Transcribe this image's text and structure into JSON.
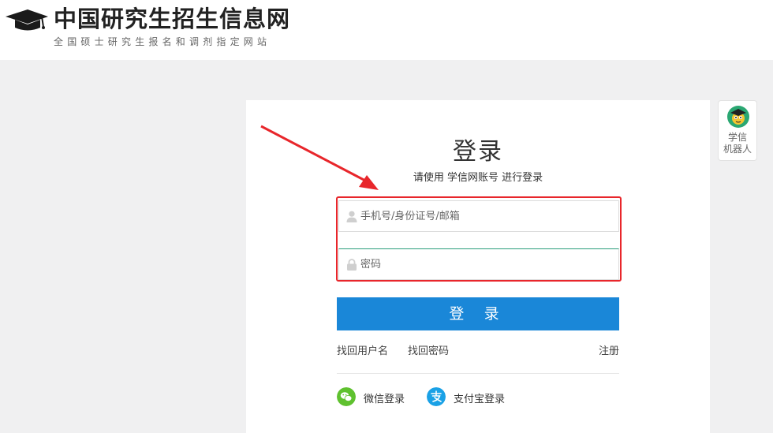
{
  "header": {
    "title": "中国研究生招生信息网",
    "subtitle": "全国硕士研究生报名和调剂指定网站"
  },
  "login": {
    "title": "登录",
    "subtitle": "请使用 学信网账号 进行登录",
    "username": {
      "placeholder": "手机号/身份证号/邮箱",
      "value": "",
      "icon": "user-icon"
    },
    "password": {
      "placeholder": "密码",
      "value": "",
      "icon": "lock-icon"
    },
    "submit_label": "登 录",
    "links": {
      "find_username": "找回用户名",
      "find_password": "找回密码",
      "register": "注册"
    },
    "social": [
      {
        "label": "微信登录",
        "icon": "wechat-icon",
        "color": "#5fc12f"
      },
      {
        "label": "支付宝登录",
        "icon": "alipay-icon",
        "color": "#1aa1e6"
      }
    ]
  },
  "robot": {
    "label_line1": "学信",
    "label_line2": "机器人"
  },
  "colors": {
    "background": "#f0f0f1",
    "accent": "#1a87d8",
    "highlight": "#e8262b",
    "focus_border": "#2a9d7a"
  }
}
